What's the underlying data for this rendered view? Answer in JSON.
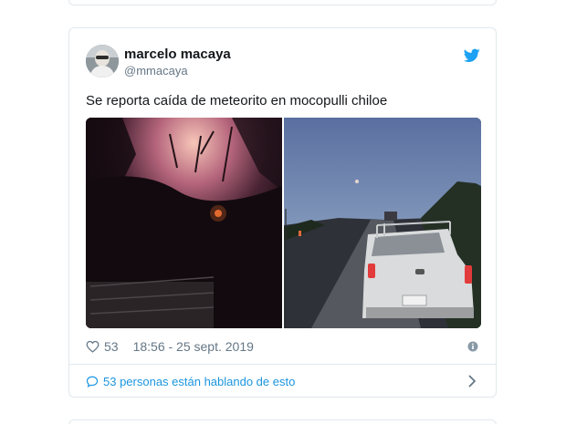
{
  "tweet": {
    "author_name": "marcelo macaya",
    "author_handle": "@mmacaya",
    "text": "Se reporta caída de meteorito en mocopulli chiloe",
    "likes": "53",
    "timestamp": "18:56 - 25 sept. 2019",
    "conversation_text": "53 personas están hablando de esto"
  },
  "icons": {
    "platform": "twitter-bird-icon",
    "like": "heart-icon",
    "info": "info-icon",
    "reply": "speech-bubble-icon",
    "open": "chevron-right-icon"
  },
  "colors": {
    "accent": "#1da1f2",
    "link": "#1b95e0",
    "muted": "#657786",
    "border": "#e1e8ed"
  }
}
